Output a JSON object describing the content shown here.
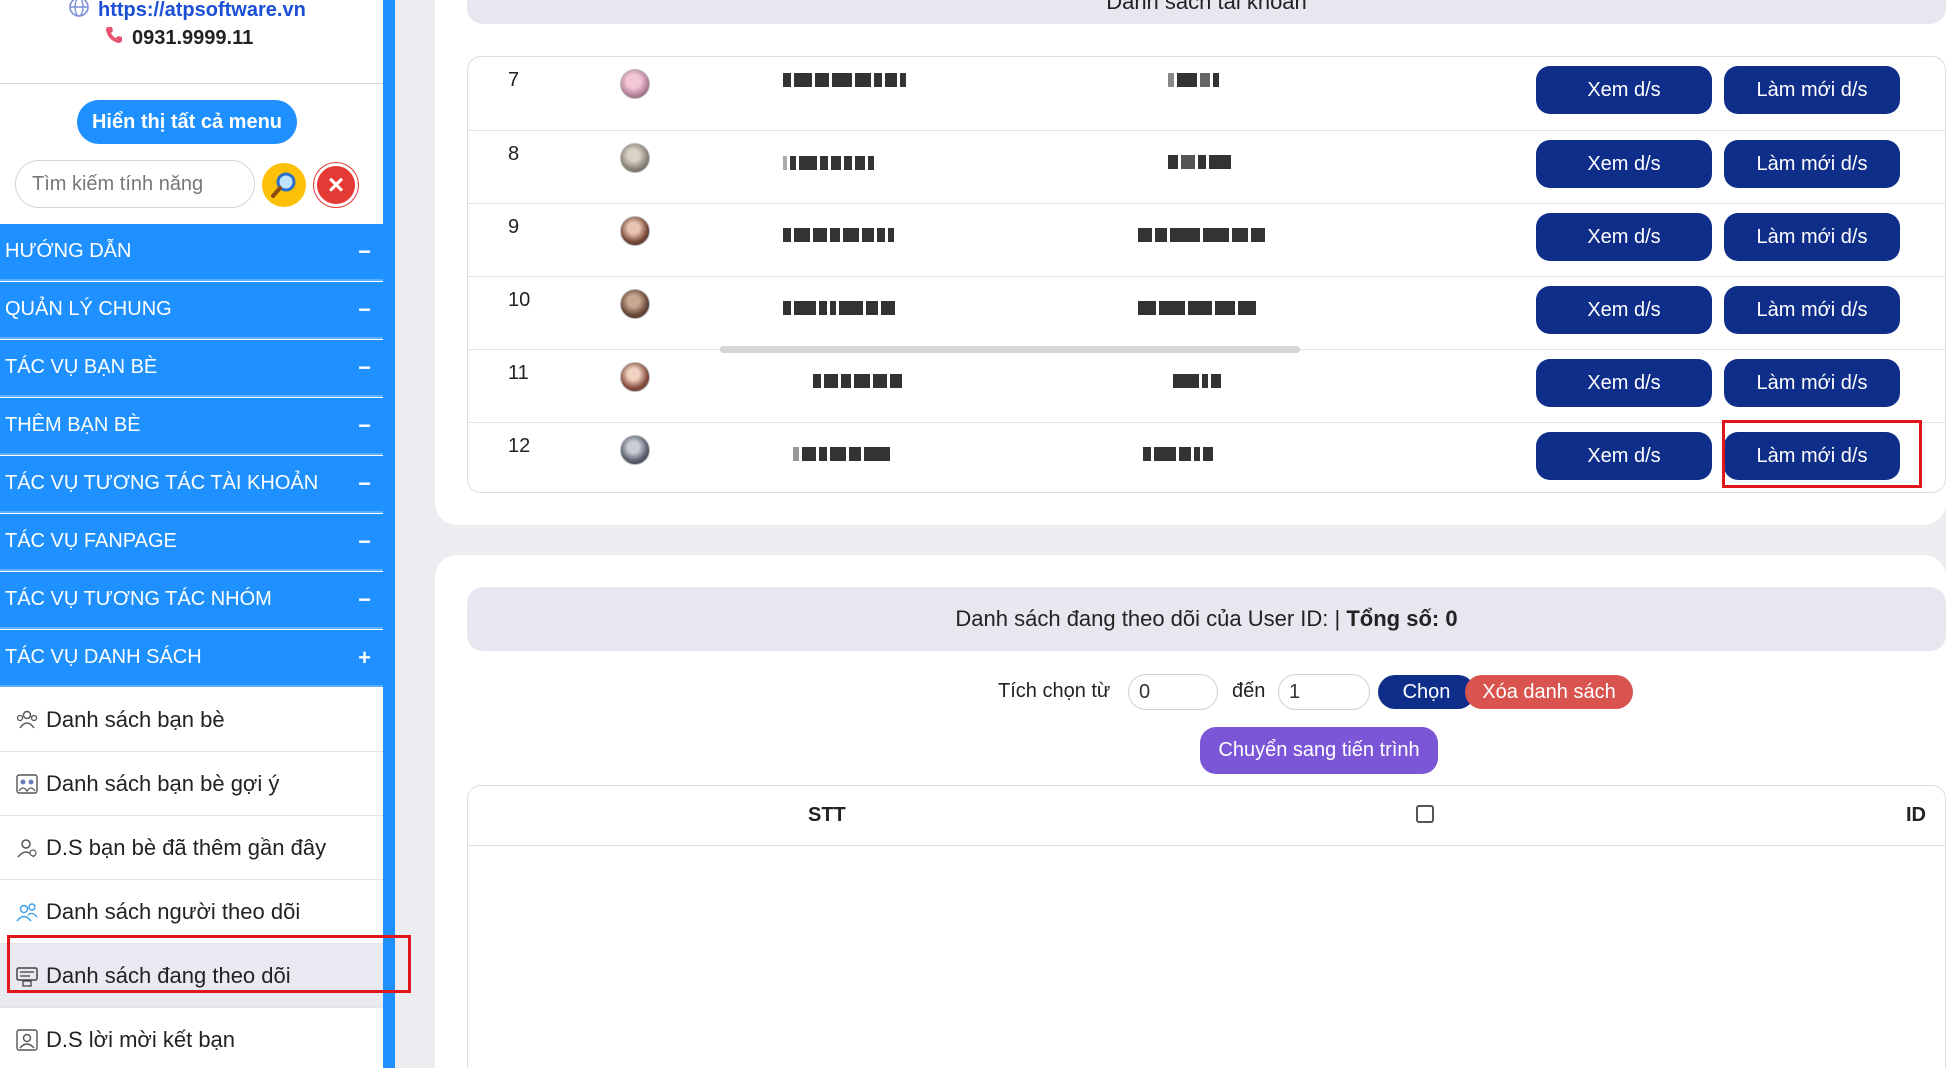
{
  "brand": {
    "url": "https://atpsoftware.vn",
    "phone": "0931.9999.11"
  },
  "sidebar": {
    "show_all_label": "Hiển thị tất cả menu",
    "search_placeholder": "Tìm kiếm tính năng",
    "groups": [
      {
        "label": "HƯỚNG DẪN",
        "sign": "−"
      },
      {
        "label": "QUẢN LÝ CHUNG",
        "sign": "−"
      },
      {
        "label": "TÁC VỤ BẠN BÈ",
        "sign": "−"
      },
      {
        "label": "THÊM BẠN BÈ",
        "sign": "−"
      },
      {
        "label": "TÁC VỤ TƯƠNG TÁC TÀI KHOẢN",
        "sign": "−"
      },
      {
        "label": "TÁC VỤ FANPAGE",
        "sign": "−"
      },
      {
        "label": "TÁC VỤ TƯƠNG TÁC NHÓM",
        "sign": "−"
      },
      {
        "label": "TÁC VỤ DANH SÁCH",
        "sign": "+"
      }
    ],
    "sub_items": [
      {
        "label": "Danh sách bạn bè",
        "icon": "friends-icon"
      },
      {
        "label": "Danh sách bạn bè gợi ý",
        "icon": "suggested-friends-icon"
      },
      {
        "label": "D.S bạn bè đã thêm gần đây",
        "icon": "recent-friend-icon"
      },
      {
        "label": "Danh sách người theo dõi",
        "icon": "followers-icon"
      },
      {
        "label": "Danh sách đang theo dõi",
        "icon": "following-icon",
        "active": true
      },
      {
        "label": "D.S lời mời kết bạn",
        "icon": "friend-request-icon"
      }
    ]
  },
  "accounts": {
    "title": "Danh sách tài khoản",
    "view_label": "Xem d/s",
    "refresh_label": "Làm mới d/s",
    "rows": [
      {
        "no": "7"
      },
      {
        "no": "8"
      },
      {
        "no": "9"
      },
      {
        "no": "10"
      },
      {
        "no": "11"
      },
      {
        "no": "12"
      }
    ]
  },
  "following": {
    "title_prefix": "Danh sách đang theo dõi của User ID: | ",
    "total_label": "Tổng số: 0",
    "range_from_label": "Tích chọn từ",
    "range_from_value": "0",
    "range_to_label": "đến",
    "range_to_value": "1",
    "choose_label": "Chọn",
    "clear_label": "Xóa danh sách",
    "move_label": "Chuyển sang tiến trình",
    "columns": [
      "STT",
      "",
      "ID"
    ]
  },
  "colors": {
    "sidebar_blue": "#1e90ff",
    "button_navy": "#0f2e8a",
    "danger_red": "#d9534f",
    "purple": "#7b57d8",
    "highlight_red": "#e0161b"
  }
}
